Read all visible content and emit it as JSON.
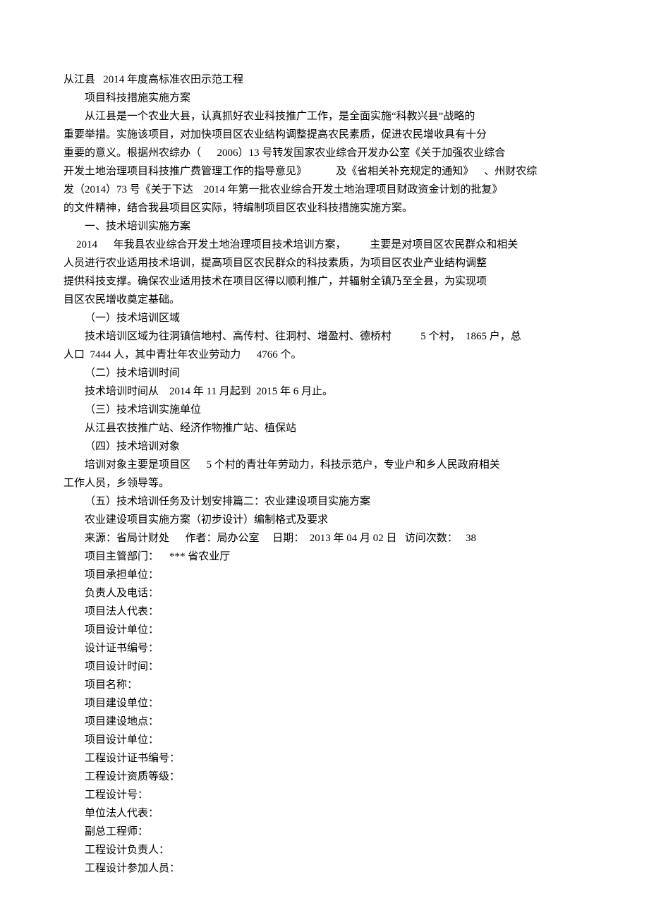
{
  "lines": [
    {
      "cls": "no-indent",
      "text": "从江县   2014 年度高标准农田示范工程"
    },
    {
      "cls": "indent1",
      "text": "项目科技措施实施方案"
    },
    {
      "cls": "indent1",
      "text": "从江县是一个农业大县，认真抓好农业科技推广工作，是全面实施“科教兴县”战略的"
    },
    {
      "cls": "no-indent",
      "text": "重要举措。实施该项目，对加快项目区农业结构调整提高农民素质，促进农民增收具有十分"
    },
    {
      "cls": "no-indent",
      "text": "重要的意义。根据州农综办（      2006）13 号转发国家农业综合开发办公室《关于加强农业综合"
    },
    {
      "cls": "no-indent",
      "text": "开发土地治理项目科技推广费管理工作的指导意见》           及《省相关补充规定的通知》    、州财农综"
    },
    {
      "cls": "no-indent",
      "text": "发（2014）73 号《关于下达    2014 年第一批农业综合开发土地治理项目财政资金计划的批复》"
    },
    {
      "cls": "no-indent",
      "text": "的文件精神，结合我县项目区实际，特编制项目区农业科技措施实施方案。"
    },
    {
      "cls": "indent1",
      "text": "一、技术培训实施方案"
    },
    {
      "cls": "indent1b",
      "text": "2014      年我县农业综合开发土地治理项目技术培训方案，         主要是对项目区农民群众和相关"
    },
    {
      "cls": "no-indent",
      "text": "人员进行农业适用技术培训，提高项目区农民群众的科技素质，为项目区农业产业结构调整"
    },
    {
      "cls": "no-indent",
      "text": "提供科技支撑。确保农业适用技术在项目区得以顺利推广，并辐射全镇乃至全县，为实现项"
    },
    {
      "cls": "no-indent",
      "text": "目区农民增收奠定基础。"
    },
    {
      "cls": "indent1",
      "text": "（一）技术培训区域"
    },
    {
      "cls": "indent1",
      "text": "技术培训区域为往洞镇信地村、高传村、往洞村、增盈村、德桥村           5 个村，  1865 户，总"
    },
    {
      "cls": "no-indent",
      "text": "人口  7444 人，其中青壮年农业劳动力      4766 个。"
    },
    {
      "cls": "indent1",
      "text": "（二）技术培训时间"
    },
    {
      "cls": "indent1",
      "text": "技术培训时间从    2014 年 11 月起到  2015 年 6 月止。"
    },
    {
      "cls": "indent1",
      "text": "（三）技术培训实施单位"
    },
    {
      "cls": "indent1",
      "text": "从江县农技推广站、经济作物推广站、植保站"
    },
    {
      "cls": "indent1",
      "text": "（四）技术培训对象"
    },
    {
      "cls": "indent1",
      "text": "培训对象主要是项目区      5 个村的青壮年劳动力，科技示范户，专业户和乡人民政府相关"
    },
    {
      "cls": "no-indent",
      "text": "工作人员，乡领导等。"
    },
    {
      "cls": "indent1",
      "text": "（五）技术培训任务及计划安排篇二：农业建设项目实施方案"
    },
    {
      "cls": "indent1",
      "text": "农业建设项目实施方案（初步设计）编制格式及要求"
    },
    {
      "cls": "indent1",
      "text": "来源：省局计财处      作者：局办公室     日期：  2013 年 04 月 02 日   访问次数：   38"
    },
    {
      "cls": "indent1",
      "text": "项目主管部门：    *** 省农业厅"
    },
    {
      "cls": "indent1",
      "text": "项目承担单位："
    },
    {
      "cls": "indent1",
      "text": "负责人及电话："
    },
    {
      "cls": "indent1",
      "text": "项目法人代表："
    },
    {
      "cls": "indent1",
      "text": "项目设计单位："
    },
    {
      "cls": "indent1",
      "text": "设计证书编号："
    },
    {
      "cls": "indent1",
      "text": "项目设计时间："
    },
    {
      "cls": "indent1",
      "text": "项目名称："
    },
    {
      "cls": "indent1",
      "text": "项目建设单位："
    },
    {
      "cls": "indent1",
      "text": "项目建设地点："
    },
    {
      "cls": "indent1",
      "text": "项目设计单位："
    },
    {
      "cls": "indent1",
      "text": "工程设计证书编号："
    },
    {
      "cls": "indent1",
      "text": "工程设计资质等级："
    },
    {
      "cls": "indent1",
      "text": "工程设计号："
    },
    {
      "cls": "indent1",
      "text": "单位法人代表："
    },
    {
      "cls": "indent1",
      "text": "副总工程师："
    },
    {
      "cls": "indent1",
      "text": "工程设计负责人："
    },
    {
      "cls": "indent1",
      "text": "工程设计参加人员："
    }
  ]
}
